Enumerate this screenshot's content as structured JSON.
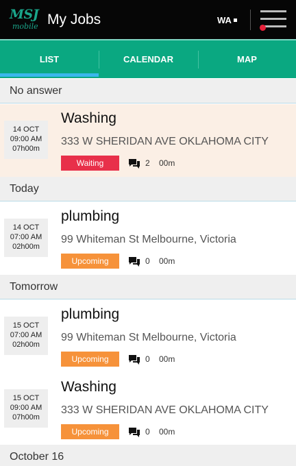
{
  "app": {
    "logo_text": "MSJ",
    "logo_sub": "mobile",
    "title": "My Jobs",
    "region": "WA"
  },
  "colors": {
    "topbar": "#060606",
    "tab_bar": "#0aa881",
    "tab_indicator": "#38b7ec",
    "waiting": "#e8304a",
    "upcoming": "#f6923a",
    "menu_dot": "#e8213a"
  },
  "tabs": [
    {
      "label": "LIST",
      "selected": true
    },
    {
      "label": "CALENDAR",
      "selected": false
    },
    {
      "label": "MAP",
      "selected": false
    }
  ],
  "sections": [
    {
      "title": "No answer",
      "jobs": [
        {
          "date": "14 OCT",
          "time": "09:00 AM",
          "duration_block": "07h00m",
          "title": "Washing",
          "address": "333 W SHERIDAN AVE OKLAHOMA CITY",
          "status": "Waiting",
          "messages": "2",
          "elapsed": "00m"
        }
      ]
    },
    {
      "title": "Today",
      "jobs": [
        {
          "date": "14 OCT",
          "time": "07:00 AM",
          "duration_block": "02h00m",
          "title": "plumbing",
          "address": "99 Whiteman St Melbourne, Victoria",
          "status": "Upcoming",
          "messages": "0",
          "elapsed": "00m"
        }
      ]
    },
    {
      "title": "Tomorrow",
      "jobs": [
        {
          "date": "15 OCT",
          "time": "07:00 AM",
          "duration_block": "02h00m",
          "title": "plumbing",
          "address": "99 Whiteman St Melbourne, Victoria",
          "status": "Upcoming",
          "messages": "0",
          "elapsed": "00m"
        },
        {
          "date": "15 OCT",
          "time": "09:00 AM",
          "duration_block": "07h00m",
          "title": "Washing",
          "address": "333 W SHERIDAN AVE OKLAHOMA CITY",
          "status": "Upcoming",
          "messages": "0",
          "elapsed": "00m"
        }
      ]
    },
    {
      "title": "October 16",
      "jobs": []
    }
  ]
}
